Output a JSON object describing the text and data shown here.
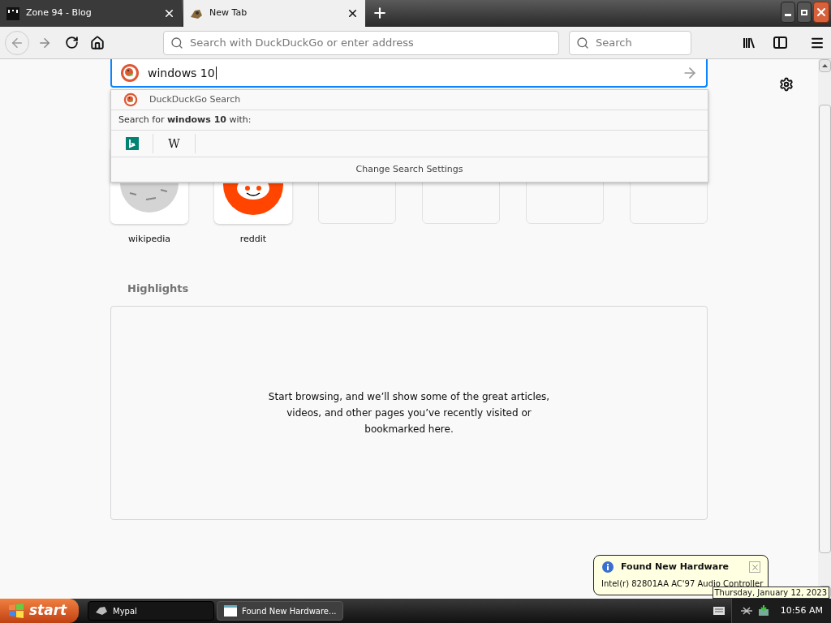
{
  "tabs": [
    {
      "title": "Zone 94 - Blog",
      "selected": false
    },
    {
      "title": "New Tab",
      "selected": true
    }
  ],
  "toolbar": {
    "address_placeholder": "Search with DuckDuckGo or enter address",
    "search_placeholder": "Search"
  },
  "search": {
    "value": "windows 10"
  },
  "suggestions": {
    "engine": "DuckDuckGo Search",
    "prompt": "Search for **windows 10** with:",
    "one_off_engines": [
      {
        "kind": "bing"
      },
      {
        "kind": "wikipedia",
        "label": "W"
      }
    ],
    "settings": "Change Search Settings"
  },
  "top_sites": [
    {
      "kind": "wikipedia",
      "label": "wikipedia"
    },
    {
      "kind": "reddit",
      "label": "reddit"
    },
    {
      "kind": "empty"
    },
    {
      "kind": "empty"
    },
    {
      "kind": "empty"
    },
    {
      "kind": "empty"
    }
  ],
  "highlights": {
    "title": "Highlights",
    "message": "Start browsing, and we’ll show some of the great articles, videos, and other pages you’ve recently visited or bookmarked here."
  },
  "notification": {
    "title": "Found New Hardware",
    "message": "Intel(r) 82801AA AC'97 Audio Controller"
  },
  "tooltip": "Thursday, January 12, 2023",
  "taskbar": {
    "start": "start",
    "tasks": [
      {
        "kind": "app",
        "label": "Mypal",
        "selected": true
      },
      {
        "kind": "window",
        "label": "Found New Hardware...",
        "selected": false
      }
    ],
    "clock": "10:56 AM"
  }
}
